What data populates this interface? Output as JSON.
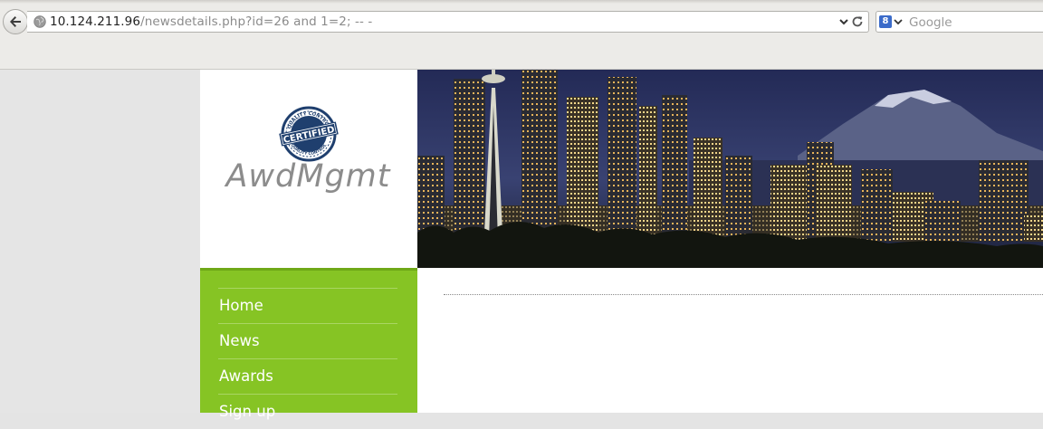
{
  "browser": {
    "url_host": "10.124.211.96",
    "url_path": "/newsdetails.php?id=26 and 1=2; -- -",
    "search_placeholder": "Google",
    "search_engine_glyph": "8",
    "icons": [
      "back-arrow-icon",
      "globe-icon",
      "chevron-down-icon",
      "reload-icon",
      "google-icon"
    ]
  },
  "site": {
    "name": "AwdMgmt",
    "badge": {
      "top_text": "QUALITY CONTROL",
      "center_text": "CERTIFIED",
      "bottom_text": "QUALITY CONTROL",
      "color": "#1f3f6e"
    },
    "banner_description_colors": {
      "sky": "#1c2547",
      "lights": "#f2c66b"
    }
  },
  "nav": {
    "items": [
      {
        "label": "Home"
      },
      {
        "label": "News"
      },
      {
        "label": "Awards"
      },
      {
        "label": "Sign up"
      }
    ]
  },
  "colors": {
    "sidebar_green": "#86c424",
    "sidebar_border": "#6fa817",
    "page_gray": "#e5e5e5"
  }
}
